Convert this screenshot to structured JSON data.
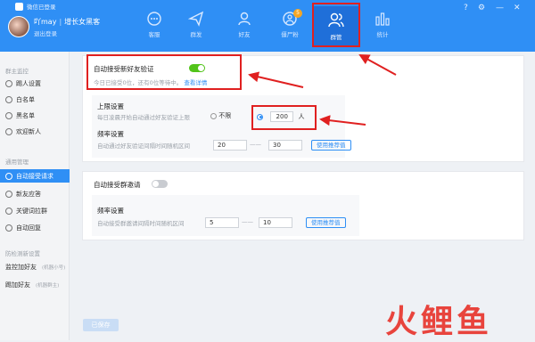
{
  "window": {
    "title": "微信已登录",
    "controls": [
      "?",
      "⚙",
      "—",
      "✕"
    ]
  },
  "user": {
    "name": "吖may",
    "role": "增长女黑客",
    "logout": "退出登录"
  },
  "nav": [
    {
      "label": "客服",
      "icon": "chat-icon"
    },
    {
      "label": "群发",
      "icon": "send-icon"
    },
    {
      "label": "好友",
      "icon": "friends-icon"
    },
    {
      "label": "僵尸粉",
      "icon": "zombie-icon",
      "badge": "5"
    },
    {
      "label": "群管",
      "icon": "group-manage-icon",
      "active": true
    },
    {
      "label": "统计",
      "icon": "stats-icon"
    }
  ],
  "sidebar": {
    "group1": "群主监控",
    "items1": [
      "踢人设置",
      "白名单",
      "黑名单",
      "欢迎新人"
    ],
    "group2": "通用管理",
    "items2": [
      "自动接受请求",
      "新友应答",
      "关键词拉群",
      "自动回复"
    ],
    "group3": "防检测新设置",
    "items3": [
      {
        "label": "监控加好友",
        "hint": "(机器小号)"
      },
      {
        "label": "踢加好友",
        "hint": "(机器群主)"
      }
    ],
    "save": "已保存"
  },
  "friend_panel": {
    "title": "自动接受新好友验证",
    "toggle_on": true,
    "status": "今日已接受0位，还有0位等待中。",
    "detail_link": "查看详情",
    "limit_title": "上限设置",
    "limit_desc": "每日凌晨开始自动通过好友验证上限",
    "no_limit": "不限",
    "limit_value": "200",
    "limit_unit": "人",
    "freq_title": "频率设置",
    "freq_desc": "自动通过好友验证间隔时间随机区间",
    "freq_min": "20",
    "freq_sep": "——",
    "freq_max": "30",
    "recommend": "使用推荐值"
  },
  "group_panel": {
    "title": "自动接受群邀请",
    "toggle_on": false,
    "freq_title": "频率设置",
    "freq_desc": "自动接受群邀请间隔时间随机区间",
    "freq_min": "5",
    "freq_sep": "——",
    "freq_max": "10",
    "recommend": "使用推荐值"
  },
  "watermark": "火鲤鱼"
}
